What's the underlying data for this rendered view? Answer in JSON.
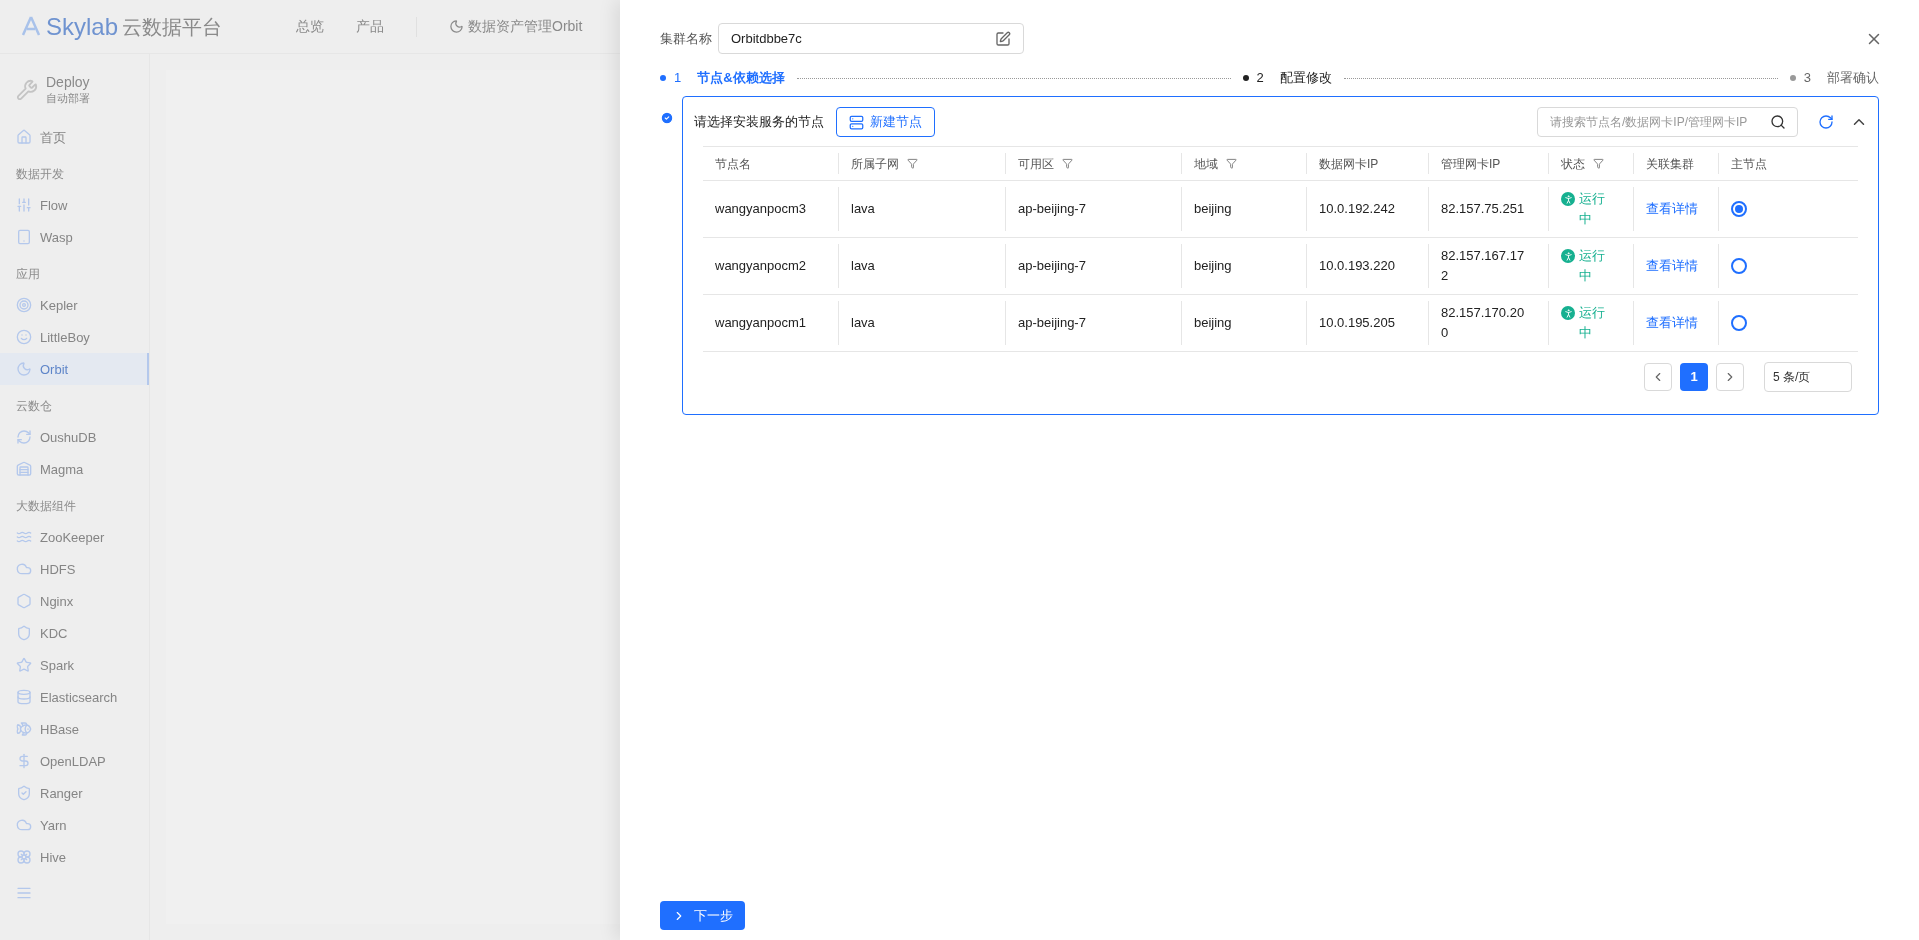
{
  "background": {
    "logo": {
      "brand": "Skylab",
      "product": "云数据平台"
    },
    "top_nav": [
      {
        "label": "总览",
        "selected": false
      },
      {
        "label": "产品",
        "selected": false
      },
      {
        "label": "数据资产管理Orbit",
        "selected": false
      }
    ],
    "sidebar": {
      "app": {
        "name": "Deploy",
        "subtitle": "自动部署"
      },
      "sections": [
        {
          "items": [
            {
              "label": "首页",
              "selected": false
            }
          ]
        },
        {
          "title": "数据开发",
          "items": [
            {
              "label": "Flow",
              "selected": false
            },
            {
              "label": "Wasp",
              "selected": false
            }
          ]
        },
        {
          "title": "应用",
          "items": [
            {
              "label": "Kepler",
              "selected": false
            },
            {
              "label": "LittleBoy",
              "selected": false
            },
            {
              "label": "Orbit",
              "selected": true
            }
          ]
        },
        {
          "title": "云数仓",
          "items": [
            {
              "label": "OushuDB",
              "selected": false
            },
            {
              "label": "Magma",
              "selected": false
            }
          ]
        },
        {
          "title": "大数据组件",
          "items": [
            {
              "label": "ZooKeeper",
              "selected": false
            },
            {
              "label": "HDFS",
              "selected": false
            },
            {
              "label": "Nginx",
              "selected": false
            },
            {
              "label": "KDC",
              "selected": false
            },
            {
              "label": "Spark",
              "selected": false
            },
            {
              "label": "Elasticsearch",
              "selected": false
            },
            {
              "label": "HBase",
              "selected": false
            },
            {
              "label": "OpenLDAP",
              "selected": false
            },
            {
              "label": "Ranger",
              "selected": false
            },
            {
              "label": "Yarn",
              "selected": false
            },
            {
              "label": "Hive",
              "selected": false
            }
          ]
        }
      ]
    }
  },
  "drawer": {
    "cluster_name": {
      "label": "集群名称",
      "value": "Orbitdbbe7c"
    },
    "steps": [
      {
        "number": "1",
        "label": "节点&依赖选择",
        "selected": true,
        "disabled": false
      },
      {
        "number": "2",
        "label": "配置修改",
        "selected": false,
        "disabled": false
      },
      {
        "number": "3",
        "label": "部署确认",
        "selected": false,
        "disabled": true
      }
    ],
    "node_panel": {
      "title": "请选择安装服务的节点",
      "new_button": "新建节点",
      "search": {
        "placeholder": "请搜索节点名/数据网卡IP/管理网卡IP"
      },
      "table": {
        "columns": [
          {
            "label": "节点名",
            "filter": false
          },
          {
            "label": "所属子网",
            "filter": true
          },
          {
            "label": "可用区",
            "filter": true
          },
          {
            "label": "地域",
            "filter": true
          },
          {
            "label": "数据网卡IP",
            "filter": false
          },
          {
            "label": "管理网卡IP",
            "filter": false
          },
          {
            "label": "状态",
            "filter": true
          },
          {
            "label": "关联集群",
            "filter": false
          },
          {
            "label": "主节点",
            "filter": false
          }
        ],
        "rows": [
          {
            "name": "wangyanpocm3",
            "subnet": "lava",
            "zone": "ap-beijing-7",
            "region": "beijing",
            "data_ip": "10.0.192.242",
            "mgmt_ip": "82.157.75.251",
            "status": "运行中",
            "link": "查看详情",
            "selected": true
          },
          {
            "name": "wangyanpocm2",
            "subnet": "lava",
            "zone": "ap-beijing-7",
            "region": "beijing",
            "data_ip": "10.0.193.220",
            "mgmt_ip": "82.157.167.172",
            "status": "运行中",
            "link": "查看详情",
            "selected": false
          },
          {
            "name": "wangyanpocm1",
            "subnet": "lava",
            "zone": "ap-beijing-7",
            "region": "beijing",
            "data_ip": "10.0.195.205",
            "mgmt_ip": "82.157.170.200",
            "status": "运行中",
            "link": "查看详情",
            "selected": false
          }
        ]
      },
      "pagination": {
        "pages": [
          {
            "label": "1",
            "selected": true
          }
        ],
        "page_size": "5 条/页"
      }
    },
    "next_button": "下一步"
  }
}
